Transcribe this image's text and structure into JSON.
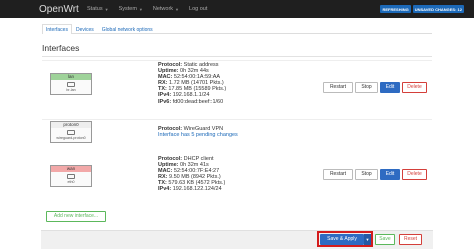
{
  "app": {
    "brand": "OpenWrt",
    "menu": [
      {
        "label": "Status"
      },
      {
        "label": "System"
      },
      {
        "label": "Network"
      },
      {
        "label": "Log out"
      }
    ],
    "badges": [
      "REFRESHING",
      "UNSAVED CHANGES: 12"
    ]
  },
  "tabs": [
    "Interfaces",
    "Devices",
    "Global network options"
  ],
  "page": {
    "heading": "Interfaces"
  },
  "interfaces": [
    {
      "name": "lan",
      "device": "br-lan",
      "color": "#9fd39a",
      "protocol_label": "Protocol:",
      "protocol": "Static address",
      "uptime_label": "Uptime:",
      "uptime": "0h 32m 44s",
      "mac_label": "MAC:",
      "mac": "52:54:00:1A:59:AA",
      "rx_label": "RX:",
      "rx": "1.72 MB (14701 Pkts.)",
      "tx_label": "TX:",
      "tx": "17.85 MB (15589 Pkts.)",
      "ipv4_label": "IPv4:",
      "ipv4": "192.168.1.1/24",
      "ipv6_label": "IPv6:",
      "ipv6": "fd00:dead:beef::1/60"
    },
    {
      "name": "proton0",
      "device": "wireguard-proton0",
      "color": "#eeeeee",
      "protocol_label": "Protocol:",
      "protocol": "WireGuard VPN",
      "pending": "Interface has 5 pending changes"
    },
    {
      "name": "wan",
      "device": "eth0",
      "color": "#f2a8a8",
      "protocol_label": "Protocol:",
      "protocol": "DHCP client",
      "uptime_label": "Uptime:",
      "uptime": "0h 32m 41s",
      "mac_label": "MAC:",
      "mac": "52:54:00:7F:E4:27",
      "rx_label": "RX:",
      "rx": "9.50 MB (8942 Pkts.)",
      "tx_label": "TX:",
      "tx": "579.63 KB (4572 Pkts.)",
      "ipv4_label": "IPv4:",
      "ipv4": "192.168.122.124/24"
    }
  ],
  "buttons": {
    "restart": "Restart",
    "stop": "Stop",
    "edit": "Edit",
    "delete": "Delete",
    "add": "Add new interface...",
    "save_apply": "Save & Apply",
    "save": "Save",
    "reset": "Reset"
  }
}
